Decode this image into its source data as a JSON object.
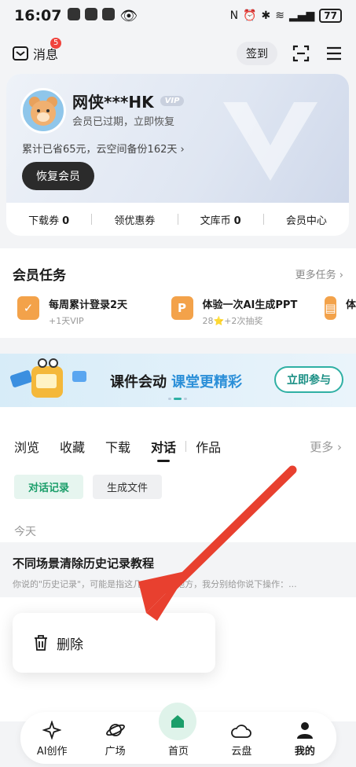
{
  "status_bar": {
    "time": "16:07",
    "battery": "77"
  },
  "top": {
    "messages_label": "消息",
    "messages_badge": "5",
    "checkin_label": "签到"
  },
  "vip_card": {
    "username": "网侠***HK",
    "vip_tag": "VIP",
    "status": "会员已过期，立即恢复",
    "accumulated": "累计已省65元，云空间备份162天 ›",
    "renew_button": "恢复会员",
    "stats": {
      "download_label": "下载券",
      "download_value": "0",
      "coupon_label": "领优惠券",
      "coin_label": "文库币",
      "coin_value": "0",
      "center_label": "会员中心"
    }
  },
  "tasks": {
    "title": "会员任务",
    "more": "更多任务 ›",
    "items": [
      {
        "name": "每周累计登录2天",
        "reward": "+1天VIP"
      },
      {
        "name": "体验一次AI生成PPT",
        "reward": "28⭐+2次抽奖"
      },
      {
        "name": "体",
        "reward": ""
      }
    ]
  },
  "banner": {
    "text_main": "课件会动",
    "text_highlight": "课堂更精彩",
    "join_button": "立即参与"
  },
  "tabs": {
    "items": [
      "浏览",
      "收藏",
      "下载",
      "对话",
      "作品"
    ],
    "active": "对话",
    "more": "更多 ›"
  },
  "chips": {
    "items": [
      "对话记录",
      "生成文件"
    ],
    "active": "对话记录"
  },
  "records": {
    "section_label": "今天",
    "items": [
      {
        "title": "不同场景清除历史记录教程",
        "snippet": "你说的\"历史记录\"，可能是指这几个不同的地方，我分别给你说下操作：..."
      }
    ]
  },
  "context_menu": {
    "delete_label": "删除"
  },
  "bottom_nav": {
    "items": [
      {
        "label": "AI创作"
      },
      {
        "label": "广场"
      },
      {
        "label": "首页"
      },
      {
        "label": "云盘"
      },
      {
        "label": "我的"
      }
    ],
    "active": "我的"
  },
  "colors": {
    "accent_green": "#1b9e6a",
    "annotation_red": "#e8402f",
    "badge_red": "#f0423c"
  }
}
